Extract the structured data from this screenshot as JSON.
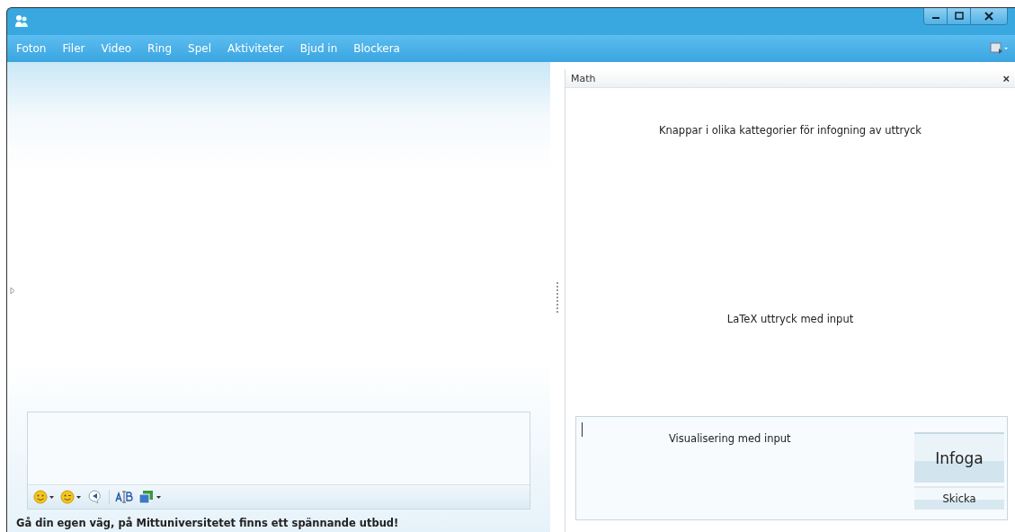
{
  "menu": [
    "Foton",
    "Filer",
    "Video",
    "Ring",
    "Spel",
    "Aktiviteter",
    "Bjud in",
    "Blockera"
  ],
  "math_panel": {
    "title": "Math",
    "close": "×",
    "categories_text": "Knappar i olika kattegorier för infogning av uttryck",
    "latex_text": "LaTeX uttryck med input",
    "visualisation_text": "Visualisering med input",
    "insert_button": "Infoga",
    "send_button": "Skicka"
  },
  "footer": "Gå din egen väg, på Mittuniversitetet finns ett spännande utbud!"
}
